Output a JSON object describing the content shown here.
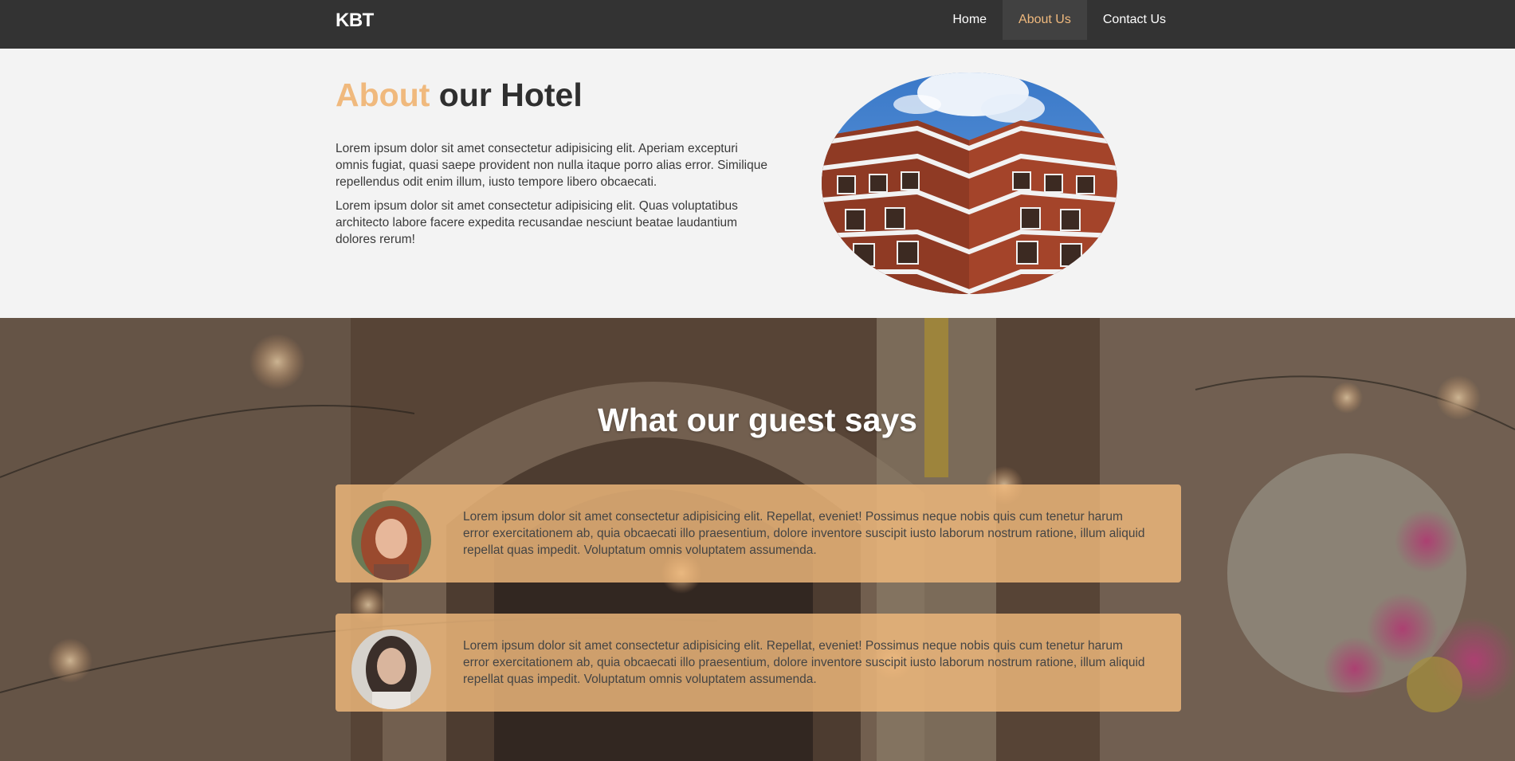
{
  "navbar": {
    "brand": "KBT",
    "items": [
      {
        "label": "Home",
        "active": false
      },
      {
        "label": "About Us",
        "active": true
      },
      {
        "label": "Contact Us",
        "active": false
      }
    ]
  },
  "about": {
    "title_accent": "About",
    "title_rest": " our Hotel",
    "paragraphs": [
      "Lorem ipsum dolor sit amet consectetur adipisicing elit. Aperiam excepturi omnis fugiat, quasi saepe provident non nulla itaque porro alias error. Similique repellendus odit enim illum, iusto tempore libero obcaecati.",
      "Lorem ipsum dolor sit amet consectetur adipisicing elit. Quas voluptatibus architecto labore facere expedita recusandae nesciunt beatae laudantium dolores rerum!"
    ]
  },
  "testimonials": {
    "title": "What our guest says",
    "items": [
      {
        "text": "Lorem ipsum dolor sit amet consectetur adipisicing elit. Repellat, eveniet! Possimus neque nobis quis cum tenetur harum error exercitationem ab, quia obcaecati illo praesentium, dolore inventore suscipit iusto laborum nostrum ratione, illum aliquid repellat quas impedit. Voluptatum omnis voluptatem assumenda."
      },
      {
        "text": "Lorem ipsum dolor sit amet consectetur adipisicing elit. Repellat, eveniet! Possimus neque nobis quis cum tenetur harum error exercitationem ab, quia obcaecati illo praesentium, dolore inventore suscipit iusto laborum nostrum ratione, illum aliquid repellat quas impedit. Voluptatum omnis voluptatem assumenda."
      }
    ]
  },
  "colors": {
    "accent": "#f0b97d",
    "navbar": "#333333",
    "nav_active_bg": "#414141",
    "card": "#f0b97d"
  }
}
